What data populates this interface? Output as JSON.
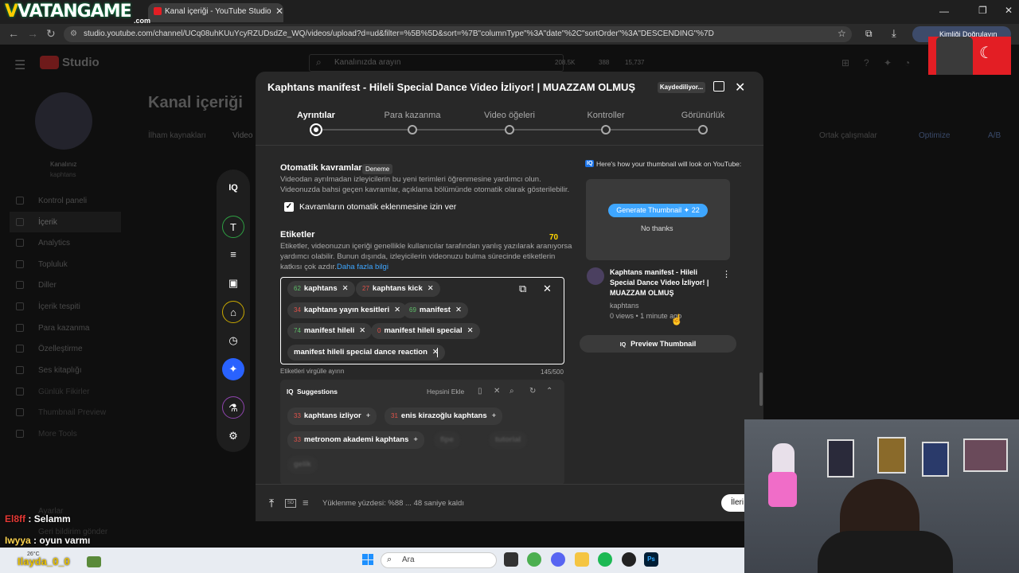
{
  "browser": {
    "brand": "VATANGAME",
    "brand_sub": ".com",
    "tab_title": "Kanal içeriği - YouTube Studio",
    "url": "studio.youtube.com/channel/UCq08uhKUuYcyRZUDsdZe_WQ/videos/upload?d=ud&filter=%5B%5D&sort=%7B\"columnType\"%3A\"date\"%2C\"sortOrder\"%3A\"DESCENDING\"%7D",
    "profile_label": "Kimliği Doğrulayın"
  },
  "studio": {
    "logo": "Studio",
    "search_placeholder": "Kanalınızda arayın",
    "stats": [
      "208.5K",
      "388",
      "15,737"
    ],
    "page_title": "Kanal içeriği",
    "channel_label": "Kanalınız",
    "channel_name": "kaphtans",
    "tabs": [
      "İlham kaynakları",
      "Video"
    ],
    "right_tabs": [
      "Ortak çalışmalar",
      "Optimize",
      "A/B"
    ],
    "sidebar": [
      "Kontrol paneli",
      "İçerik",
      "Analytics",
      "Topluluk",
      "Diller",
      "İçerik tespiti",
      "Para kazanma",
      "Özelleştirme",
      "Ses kitaplığı",
      "Günlük Fikirler",
      "Thumbnail Preview",
      "More Tools"
    ],
    "sidebar_bottom": [
      "Ayarlar",
      "Geri bildirim gönder"
    ]
  },
  "modal": {
    "title": "Kaphtans manifest - Hileli Special Dance Video İzliyor! | MUAZZAM OLMUŞ",
    "saving": "Kaydediliyor...",
    "steps": [
      "Ayrıntılar",
      "Para kazanma",
      "Video öğeleri",
      "Kontroller",
      "Görünürlük"
    ],
    "auto_concepts": {
      "heading": "Otomatik kavramlar",
      "badge": "Deneme",
      "desc_1": "Videodan ayrılmadan izleyicilerin bu yeni terimleri öğrenmesine yardımcı olun.",
      "desc_2": "Videonuzda bahsi geçen kavramlar, açıklama bölümünde otomatik olarak gösterilebilir.",
      "checkbox_label": "Kavramların otomatik eklenmesine izin ver"
    },
    "tags": {
      "heading": "Etiketler",
      "score": "70",
      "desc_1": "Etiketler, videonuzun içeriği genellikle kullanıcılar tarafından yanlış yazılarak aranıyorsa",
      "desc_2": "yardımcı olabilir. Bunun dışında, izleyicilerin videonuzu bulma sürecinde etiketlerin",
      "desc_3": "katkısı çok azdır.",
      "learn_more": "Daha fazla bilgi",
      "items": [
        {
          "score": "62",
          "label": "kaphtans",
          "color": "#5fbf6a"
        },
        {
          "score": "27",
          "label": "kaphtans kick",
          "color": "#e0524a"
        },
        {
          "score": "34",
          "label": "kaphtans yayın kesitleri",
          "color": "#e0524a"
        },
        {
          "score": "69",
          "label": "manifest",
          "color": "#5fbf6a"
        },
        {
          "score": "74",
          "label": "manifest hileli",
          "color": "#5fbf6a"
        },
        {
          "score": "0",
          "label": "manifest hileli special",
          "color": "#e0524a"
        },
        {
          "score": "",
          "label": "manifest hileli special dance reaction",
          "color": "#fff"
        }
      ],
      "hint": "Etiketleri virgülle ayırın",
      "count": "145/500"
    },
    "suggestions": {
      "title": "Suggestions",
      "add_all": "Hepsini Ekle",
      "items": [
        {
          "score": "33",
          "label": "kaphtans izliyor"
        },
        {
          "score": "31",
          "label": "enis kirazoğlu kaphtans"
        },
        {
          "score": "33",
          "label": "metronom akademi kaphtans"
        },
        {
          "score": "",
          "label": "fipe"
        },
        {
          "score": "",
          "label": "tutorial"
        },
        {
          "score": "",
          "label": "gelik"
        }
      ]
    },
    "thumbnail": {
      "header": "Here's how your thumbnail will look on YouTube:",
      "generate": "Generate Thumbnail",
      "credits": "22",
      "no_thanks": "No thanks",
      "video_title": "Kaphtans manifest - Hileli Special Dance Video İzliyor! | MUAZZAM OLMUŞ",
      "channel": "kaphtans",
      "meta": "0 views • 1 minute ago",
      "preview_button": "Preview Thumbnail"
    },
    "footer": {
      "status": "Yüklenme yüzdesi: %88 ... 48 saniye kaldı",
      "next": "İleri"
    }
  },
  "chat": [
    {
      "user": "El8ff",
      "msg": "Selamm",
      "color": "#e53935"
    },
    {
      "user": "Iwyya",
      "msg": "oyun varmı",
      "color": "#ffd54f"
    }
  ],
  "taskbar": {
    "temp": "26°C",
    "watermark": "Ilayda_0_0",
    "search": "Ara"
  }
}
